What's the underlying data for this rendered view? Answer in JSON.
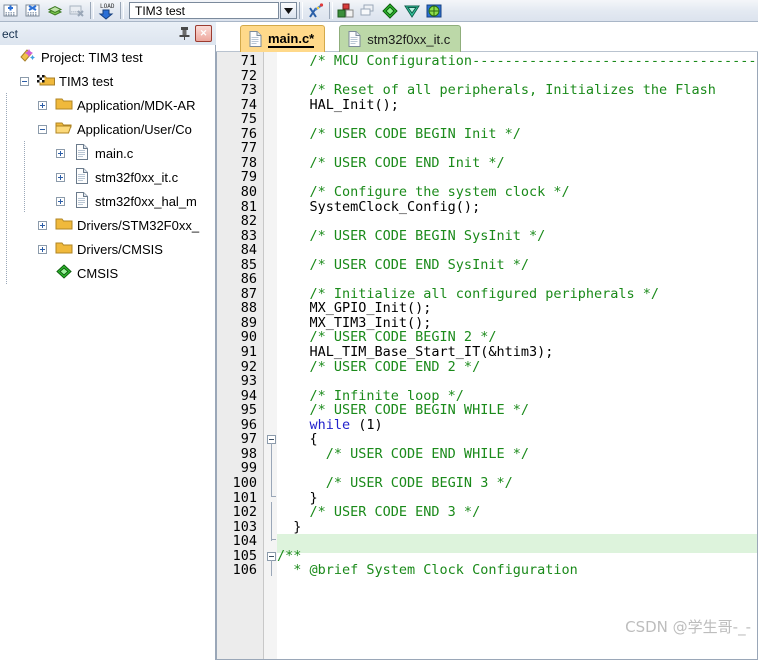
{
  "toolbar": {
    "icons": [
      {
        "name": "insert-bookmark-icon"
      },
      {
        "name": "clear-bookmarks-icon"
      },
      {
        "name": "bookmarks-icon"
      },
      {
        "name": "build-stack-icon"
      },
      {
        "name": "clear-all-icon"
      },
      {
        "name": "load-download-icon"
      }
    ],
    "project_combo": {
      "value": "TIM3 test",
      "dropdown_arrow": "▼"
    },
    "right_icons": [
      {
        "name": "configuration-wizard-icon"
      },
      {
        "name": "manage-project-items-icon"
      },
      {
        "name": "multi-project-icon"
      },
      {
        "name": "packs-green-icon"
      },
      {
        "name": "packs-teal-icon"
      },
      {
        "name": "packs-globe-icon"
      }
    ]
  },
  "project_pane": {
    "title": "ect",
    "pin_icon": "pin-icon",
    "close_label": "✕",
    "tree": [
      {
        "indent": 0,
        "toggle": "none",
        "icon": "project-icon",
        "label": "Project: TIM3 test"
      },
      {
        "indent": 1,
        "toggle": "minus",
        "icon": "target-icon",
        "label": "TIM3 test"
      },
      {
        "indent": 2,
        "toggle": "plus",
        "icon": "folder-closed",
        "label": "Application/MDK-AR"
      },
      {
        "indent": 2,
        "toggle": "minus",
        "icon": "folder-open",
        "label": "Application/User/Co"
      },
      {
        "indent": 3,
        "toggle": "plus",
        "icon": "c-file-icon",
        "label": "main.c"
      },
      {
        "indent": 3,
        "toggle": "plus",
        "icon": "c-file-icon",
        "label": "stm32f0xx_it.c"
      },
      {
        "indent": 3,
        "toggle": "plus",
        "icon": "c-file-icon",
        "label": "stm32f0xx_hal_m"
      },
      {
        "indent": 2,
        "toggle": "plus",
        "icon": "folder-closed",
        "label": "Drivers/STM32F0xx_"
      },
      {
        "indent": 2,
        "toggle": "plus",
        "icon": "folder-closed",
        "label": "Drivers/CMSIS"
      },
      {
        "indent": 2,
        "toggle": "none",
        "icon": "cmsis-icon",
        "label": "CMSIS"
      }
    ]
  },
  "editor": {
    "tabs": [
      {
        "label": "main.c*",
        "active": true,
        "icon": "source-file-icon"
      },
      {
        "label": "stm32f0xx_it.c",
        "active": false,
        "icon": "source-file-icon"
      }
    ],
    "first_line_number": 71,
    "highlight_line": 104,
    "watermark": "CSDN @学生哥-_-",
    "lines": [
      {
        "n": 71,
        "fold": "none",
        "tokens": [
          {
            "t": "    /* MCU Configuration--------------------------------------------------------",
            "c": "cm"
          }
        ]
      },
      {
        "n": 72,
        "fold": "none",
        "tokens": []
      },
      {
        "n": 73,
        "fold": "none",
        "tokens": [
          {
            "t": "    /* Reset of all peripherals, Initializes the Flash",
            "c": "cm"
          }
        ]
      },
      {
        "n": 74,
        "fold": "none",
        "tokens": [
          {
            "t": "    HAL_Init();",
            "c": ""
          }
        ]
      },
      {
        "n": 75,
        "fold": "none",
        "tokens": []
      },
      {
        "n": 76,
        "fold": "none",
        "tokens": [
          {
            "t": "    /* USER CODE BEGIN Init */",
            "c": "cm"
          }
        ]
      },
      {
        "n": 77,
        "fold": "none",
        "tokens": []
      },
      {
        "n": 78,
        "fold": "none",
        "tokens": [
          {
            "t": "    /* USER CODE END Init */",
            "c": "cm"
          }
        ]
      },
      {
        "n": 79,
        "fold": "none",
        "tokens": []
      },
      {
        "n": 80,
        "fold": "none",
        "tokens": [
          {
            "t": "    /* Configure the system clock */",
            "c": "cm"
          }
        ]
      },
      {
        "n": 81,
        "fold": "none",
        "tokens": [
          {
            "t": "    SystemClock_Config();",
            "c": ""
          }
        ]
      },
      {
        "n": 82,
        "fold": "none",
        "tokens": []
      },
      {
        "n": 83,
        "fold": "none",
        "tokens": [
          {
            "t": "    /* USER CODE BEGIN SysInit */",
            "c": "cm"
          }
        ]
      },
      {
        "n": 84,
        "fold": "none",
        "tokens": []
      },
      {
        "n": 85,
        "fold": "none",
        "tokens": [
          {
            "t": "    /* USER CODE END SysInit */",
            "c": "cm"
          }
        ]
      },
      {
        "n": 86,
        "fold": "none",
        "tokens": []
      },
      {
        "n": 87,
        "fold": "none",
        "tokens": [
          {
            "t": "    /* Initialize all configured peripherals */",
            "c": "cm"
          }
        ]
      },
      {
        "n": 88,
        "fold": "none",
        "tokens": [
          {
            "t": "    MX_GPIO_Init();",
            "c": ""
          }
        ]
      },
      {
        "n": 89,
        "fold": "none",
        "tokens": [
          {
            "t": "    MX_TIM3_Init();",
            "c": ""
          }
        ]
      },
      {
        "n": 90,
        "fold": "none",
        "tokens": [
          {
            "t": "    /* USER CODE BEGIN 2 */",
            "c": "cm"
          }
        ]
      },
      {
        "n": 91,
        "fold": "none",
        "tokens": [
          {
            "t": "    HAL_TIM_Base_Start_IT(&htim3);",
            "c": ""
          }
        ]
      },
      {
        "n": 92,
        "fold": "none",
        "tokens": [
          {
            "t": "    /* USER CODE END 2 */",
            "c": "cm"
          }
        ]
      },
      {
        "n": 93,
        "fold": "none",
        "tokens": []
      },
      {
        "n": 94,
        "fold": "none",
        "tokens": [
          {
            "t": "    /* Infinite loop */",
            "c": "cm"
          }
        ]
      },
      {
        "n": 95,
        "fold": "none",
        "tokens": [
          {
            "t": "    /* USER CODE BEGIN WHILE */",
            "c": "cm"
          }
        ]
      },
      {
        "n": 96,
        "fold": "none",
        "tokens": [
          {
            "t": "    ",
            "c": ""
          },
          {
            "t": "while",
            "c": "kw"
          },
          {
            "t": " (1)",
            "c": ""
          }
        ]
      },
      {
        "n": 97,
        "fold": "minus",
        "tokens": [
          {
            "t": "    {",
            "c": ""
          }
        ]
      },
      {
        "n": 98,
        "fold": "bar",
        "tokens": [
          {
            "t": "      /* USER CODE END WHILE */",
            "c": "cm"
          }
        ]
      },
      {
        "n": 99,
        "fold": "bar",
        "tokens": []
      },
      {
        "n": 100,
        "fold": "bar",
        "tokens": [
          {
            "t": "      /* USER CODE BEGIN 3 */",
            "c": "cm"
          }
        ]
      },
      {
        "n": 101,
        "fold": "barend",
        "tokens": [
          {
            "t": "    }",
            "c": ""
          }
        ]
      },
      {
        "n": 102,
        "fold": "bar2",
        "tokens": [
          {
            "t": "    /* USER CODE END 3 */",
            "c": "cm"
          }
        ]
      },
      {
        "n": 103,
        "fold": "bar2",
        "tokens": [
          {
            "t": "  }",
            "c": ""
          }
        ]
      },
      {
        "n": 104,
        "fold": "bar2end",
        "tokens": []
      },
      {
        "n": 105,
        "fold": "minus",
        "tokens": [
          {
            "t": "/**",
            "c": "cm"
          }
        ]
      },
      {
        "n": 106,
        "fold": "bar",
        "tokens": [
          {
            "t": "  * @brief System Clock Configuration",
            "c": "cm"
          }
        ]
      }
    ]
  }
}
